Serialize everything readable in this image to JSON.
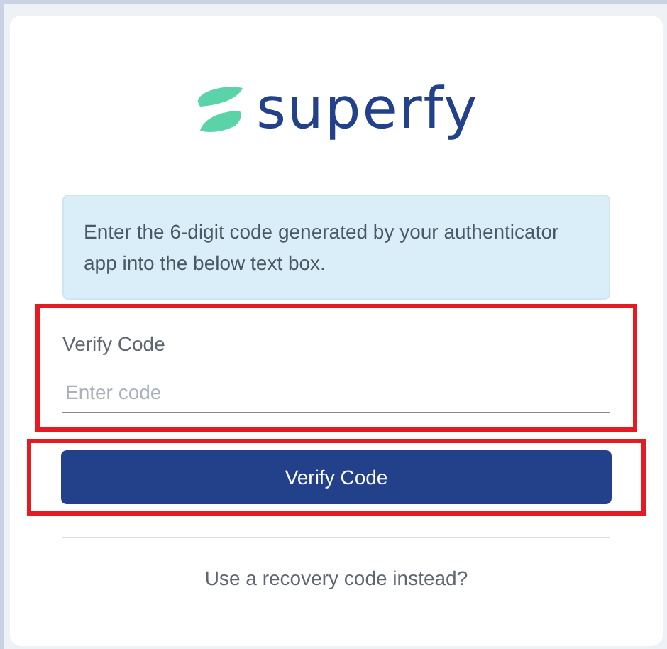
{
  "logo": {
    "text": "superfy"
  },
  "info": {
    "text": "Enter the 6-digit code generated by your authenticator app into the below text box."
  },
  "code_field": {
    "label": "Verify Code",
    "placeholder": "Enter code",
    "highlighted": true
  },
  "verify_button": {
    "label": "Verify Code",
    "highlighted": true
  },
  "recovery_link": {
    "text": "Use a recovery code instead?"
  }
}
